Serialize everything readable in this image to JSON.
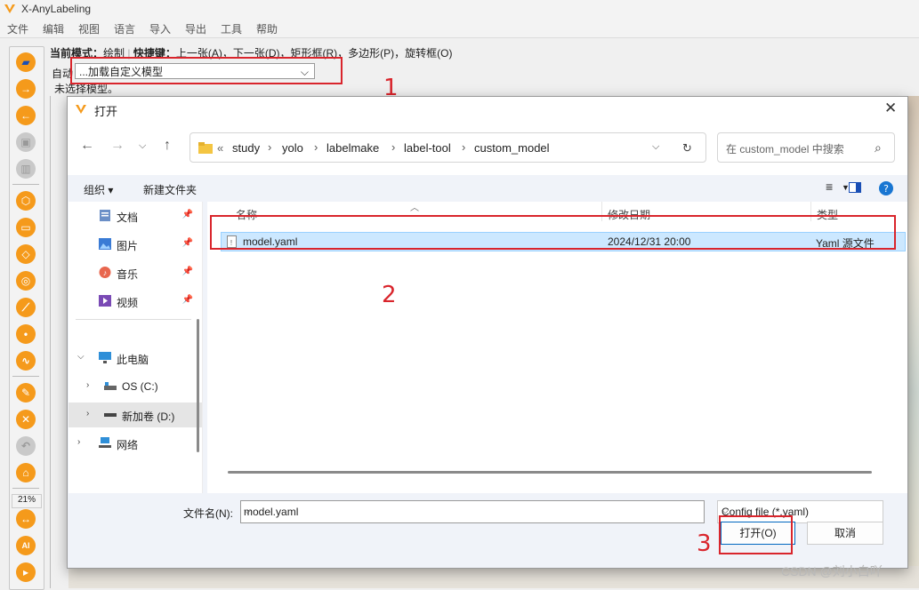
{
  "app": {
    "title": "X-AnyLabeling",
    "accent": "#f59a1b"
  },
  "menu": [
    "文件",
    "编辑",
    "视图",
    "语言",
    "导入",
    "导出",
    "工具",
    "帮助"
  ],
  "toolbar": {
    "zoom": "21%",
    "ai_label": "AI"
  },
  "mode_line": {
    "mode_label": "当前模式：",
    "mode_value": "绘制",
    "shortcut_label": "快捷键：",
    "shortcut_value": "上一张(A)，下一张(D)，矩形框(R)，多边形(P)，旋转框(O)"
  },
  "auto": {
    "label": "自动",
    "model_value": "...加载自定义模型",
    "status": "未选择模型。"
  },
  "annotations": {
    "n1": "1",
    "n2": "2",
    "n3": "3",
    "color": "#d9252c"
  },
  "dialog": {
    "title": "打开",
    "breadcrumb": [
      "«",
      "study",
      "yolo",
      "labelmake",
      "label-tool",
      "custom_model"
    ],
    "search_placeholder": "在 custom_model 中搜索",
    "organize": "组织 ▾",
    "new_folder": "新建文件夹",
    "nav_quick": [
      {
        "label": "文档"
      },
      {
        "label": "图片"
      },
      {
        "label": "音乐"
      },
      {
        "label": "视频"
      }
    ],
    "nav_tree": [
      {
        "label": "此电脑"
      },
      {
        "label": "OS (C:)"
      },
      {
        "label": "新加卷 (D:)"
      },
      {
        "label": "网络"
      }
    ],
    "columns": {
      "name": "名称",
      "modified": "修改日期",
      "type": "类型"
    },
    "files": [
      {
        "name": "model.yaml",
        "modified": "2024/12/31 20:00",
        "type": "Yaml 源文件"
      }
    ],
    "filename_label": "文件名(N):",
    "filename_value": "model.yaml",
    "filter": "Config file (*.yaml)",
    "open_button": "打开(O)",
    "cancel_button": "取消"
  },
  "watermark": "CSDN @刘小白吖"
}
